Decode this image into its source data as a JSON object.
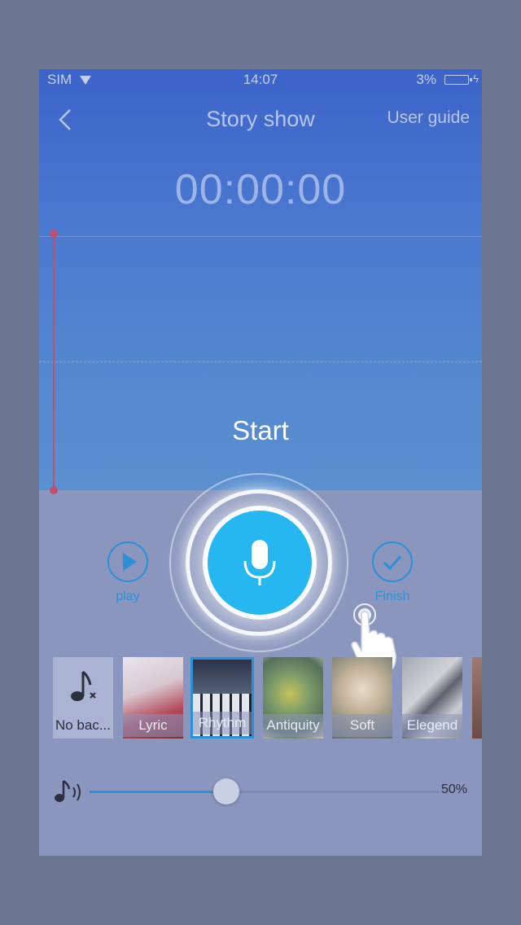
{
  "status_bar": {
    "carrier": "SIM",
    "time": "14:07",
    "battery": "3%"
  },
  "header": {
    "title": "Story show",
    "user_guide_label": "User guide",
    "back_icon": "chevron-left-icon"
  },
  "timer": "00:00:00",
  "recorder": {
    "start_label": "Start",
    "play_label": "play",
    "finish_label": "Finish",
    "accent_color": "#26b6f0",
    "button_color": "#2d8fd8",
    "cursor_color": "#c0506f"
  },
  "backgrounds": {
    "selected": "Rhythm",
    "items": [
      {
        "label": "No bac...",
        "icon": "music-note-mute-icon"
      },
      {
        "label": "Lyric"
      },
      {
        "label": "Rhythm"
      },
      {
        "label": "Antiquity"
      },
      {
        "label": "Soft"
      },
      {
        "label": "Elegend"
      },
      {
        "label": ""
      }
    ]
  },
  "volume": {
    "label": "50%",
    "level": 0.39,
    "icon": "music-volume-icon"
  }
}
